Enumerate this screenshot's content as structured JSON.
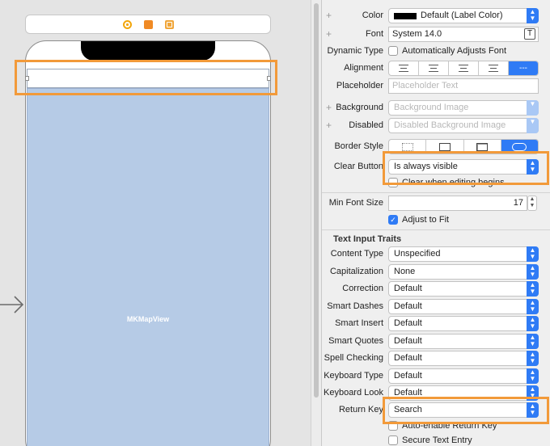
{
  "canvas": {
    "mapview_label": "MKMapView"
  },
  "inspector": {
    "color": {
      "label": "Color",
      "value": "Default (Label Color)"
    },
    "font": {
      "label": "Font",
      "value": "System 14.0",
      "button": "T"
    },
    "dynamic_type": {
      "label": "Dynamic Type",
      "checkbox": "Automatically Adjusts Font"
    },
    "alignment": {
      "label": "Alignment",
      "selected": "---"
    },
    "placeholder": {
      "label": "Placeholder",
      "placeholder": "Placeholder Text"
    },
    "background": {
      "label": "Background",
      "value": "Background Image"
    },
    "disabled": {
      "label": "Disabled",
      "value": "Disabled Background Image"
    },
    "border_style": {
      "label": "Border Style"
    },
    "clear_button": {
      "label": "Clear Button",
      "value": "Is always visible",
      "checkbox": "Clear when editing begins"
    },
    "min_font_size": {
      "label": "Min Font Size",
      "value": "17"
    },
    "adjust_to_fit": {
      "label": "Adjust to Fit"
    },
    "traits_title": "Text Input Traits",
    "traits": [
      {
        "label": "Content Type",
        "value": "Unspecified"
      },
      {
        "label": "Capitalization",
        "value": "None"
      },
      {
        "label": "Correction",
        "value": "Default"
      },
      {
        "label": "Smart Dashes",
        "value": "Default"
      },
      {
        "label": "Smart Insert",
        "value": "Default"
      },
      {
        "label": "Smart Quotes",
        "value": "Default"
      },
      {
        "label": "Spell Checking",
        "value": "Default"
      },
      {
        "label": "Keyboard Type",
        "value": "Default"
      },
      {
        "label": "Keyboard Look",
        "value": "Default"
      },
      {
        "label": "Return Key",
        "value": "Search"
      }
    ],
    "auto_enable": "Auto-enable Return Key",
    "secure": "Secure Text Entry"
  },
  "colors": {
    "accent": "#2f7bf5",
    "highlight": "#f29a3a",
    "mapview": "#b6cbe6"
  }
}
